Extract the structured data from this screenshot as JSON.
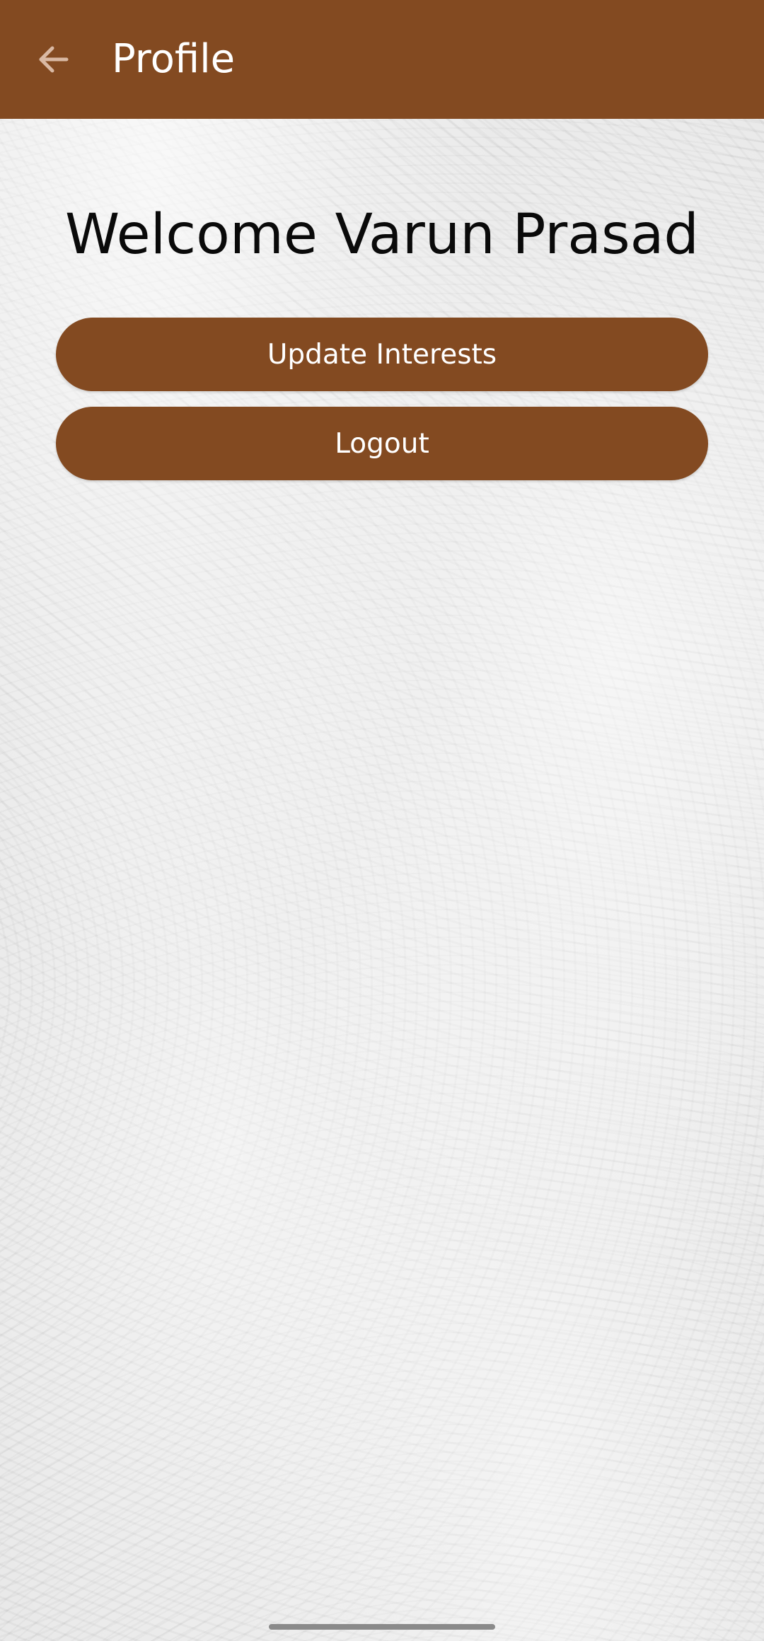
{
  "app_bar": {
    "title": "Profile",
    "back_icon": "arrow-left-icon",
    "background_color": "#834a21"
  },
  "main": {
    "welcome_text": "Welcome Varun Prasad",
    "buttons": [
      {
        "label": "Update Interests"
      },
      {
        "label": "Logout"
      }
    ],
    "button_color": "#834a21"
  }
}
